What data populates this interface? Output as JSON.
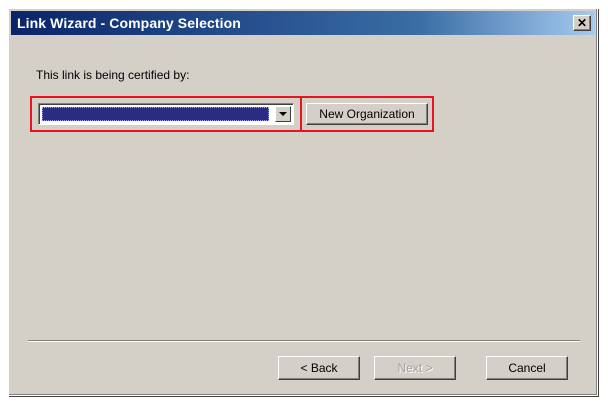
{
  "window": {
    "title": "Link Wizard - Company Selection",
    "close_glyph": "✕"
  },
  "form": {
    "prompt": "This link is being certified by:",
    "company_select": {
      "value": "",
      "icon": "chevron-down-icon"
    },
    "new_org_label": "New Organization"
  },
  "footer": {
    "back_label": "< Back",
    "next_label": "Next >",
    "next_enabled": false,
    "cancel_label": "Cancel"
  },
  "colors": {
    "titlebar_start": "#0a246a",
    "highlight_outline": "#e8131f",
    "selection": "#2a2c84",
    "face": "#d4d0c8"
  }
}
